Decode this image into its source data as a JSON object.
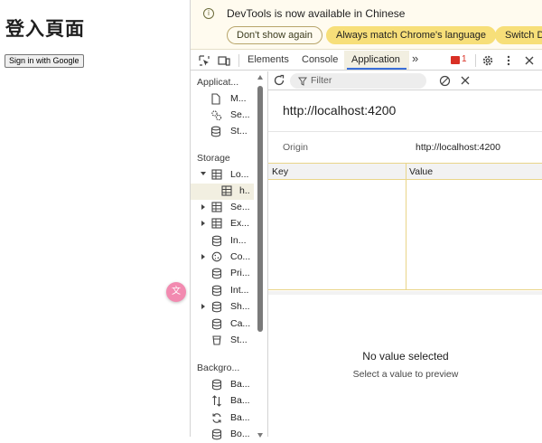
{
  "page": {
    "heading": "登入頁面",
    "sign_in_button": "Sign in with Google",
    "translate_fab_icon": "translate-icon"
  },
  "infobar": {
    "message": "DevTools is now available in Chinese",
    "dont_show": "Don't show again",
    "match_language": "Always match Chrome's language",
    "switch_devtools": "Switch De"
  },
  "tabs": {
    "elements": "Elements",
    "console": "Console",
    "application": "Application",
    "more": "»",
    "error_count": "1"
  },
  "sidebar": {
    "application_header": "Applicat...",
    "app_items": [
      "M...",
      "Se...",
      "St..."
    ],
    "storage_header": "Storage",
    "storage_items": [
      {
        "label": "Lo...",
        "expanded": true
      },
      {
        "label": "h..",
        "child": true,
        "selected": true
      },
      {
        "label": "Se..."
      },
      {
        "label": "Ex..."
      },
      {
        "label": "In..."
      },
      {
        "label": "Co..."
      },
      {
        "label": "Pri..."
      },
      {
        "label": "Int..."
      },
      {
        "label": "Sh..."
      },
      {
        "label": "Ca..."
      },
      {
        "label": "St..."
      }
    ],
    "background_header": "Backgro...",
    "background_items": [
      "Ba...",
      "Ba...",
      "Ba...",
      "Bo..."
    ]
  },
  "main": {
    "filter_placeholder": "Filter",
    "url_title": "http://localhost:4200",
    "origin_label": "Origin",
    "origin_value": "http://localhost:4200",
    "col_key": "Key",
    "col_value": "Value",
    "preview_title": "No value selected",
    "preview_subtitle": "Select a value to preview"
  },
  "colors": {
    "infobar_bg": "#fffbef",
    "infobar_button": "#f7df79",
    "active_tab_underline": "#3a6fd8",
    "error_badge": "#d93025",
    "translate_fab": "#f28ab0"
  }
}
